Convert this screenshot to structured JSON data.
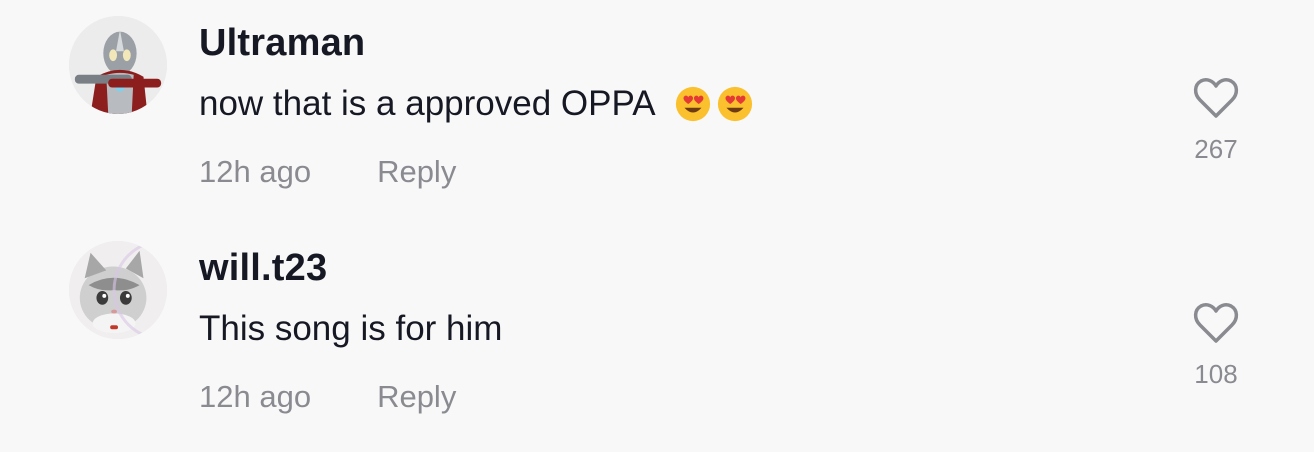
{
  "comments": [
    {
      "username": "Ultraman",
      "text": "now that is a approved OPPA",
      "emojis": [
        "heart-eyes-emoji",
        "heart-eyes-emoji"
      ],
      "timestamp": "12h ago",
      "reply_label": "Reply",
      "likes": "267"
    },
    {
      "username": "will.t23",
      "text": "This song is for him",
      "emojis": [],
      "timestamp": "12h ago",
      "reply_label": "Reply",
      "likes": "108"
    }
  ],
  "colors": {
    "background": "#f8f8f8",
    "primary_text": "#161823",
    "secondary_text": "#8a8b91",
    "heart_outline": "#8a8b91"
  },
  "icons": {
    "like": "heart-outline-icon"
  }
}
